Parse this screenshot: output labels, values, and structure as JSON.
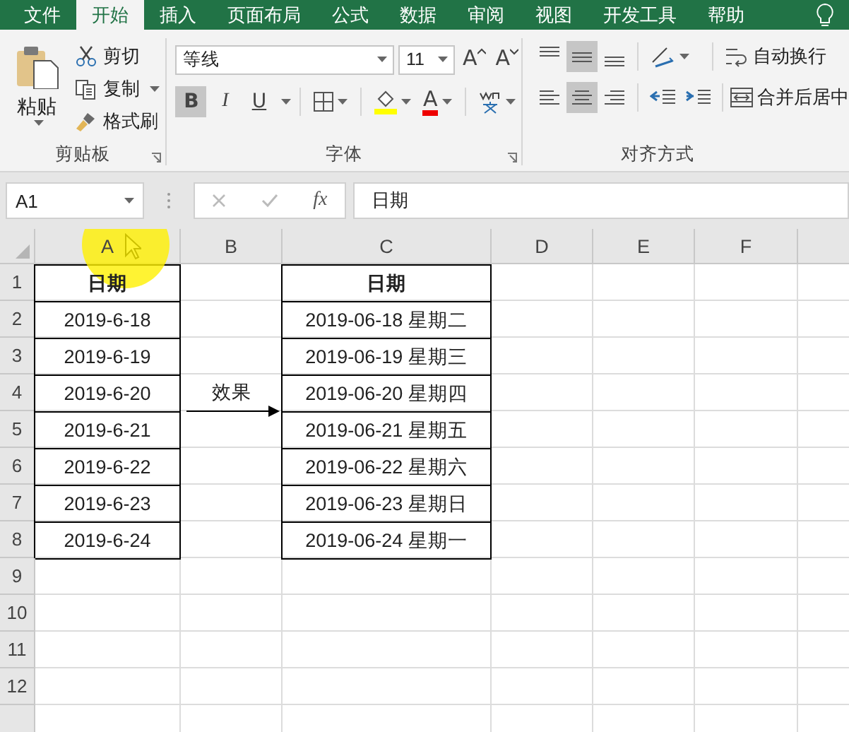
{
  "menu_tabs": [
    {
      "label": "文件",
      "selected": false
    },
    {
      "label": "开始",
      "selected": true
    },
    {
      "label": "插入",
      "selected": false
    },
    {
      "label": "页面布局",
      "selected": false
    },
    {
      "label": "公式",
      "selected": false
    },
    {
      "label": "数据",
      "selected": false
    },
    {
      "label": "审阅",
      "selected": false
    },
    {
      "label": "视图",
      "selected": false
    },
    {
      "label": "开发工具",
      "selected": false
    },
    {
      "label": "帮助",
      "selected": false
    }
  ],
  "ribbon": {
    "clipboard": {
      "paste": "粘贴",
      "actions": [
        {
          "kind": "cut",
          "label": "剪切"
        },
        {
          "kind": "copy",
          "label": "复制"
        },
        {
          "kind": "painter",
          "label": "格式刷"
        }
      ],
      "label": "剪贴板"
    },
    "font": {
      "font_name": "等线",
      "font_size": "11",
      "grow_font": "A",
      "shrink_font": "A",
      "styles": [
        {
          "kind": "bold",
          "label": "B",
          "selected": true
        },
        {
          "kind": "italic",
          "label": "I",
          "selected": false
        },
        {
          "kind": "underline",
          "label": "U",
          "selected": false
        }
      ],
      "font_color": "A",
      "label": "字体"
    },
    "alignment": {
      "vertical_align": [
        {
          "kind": "top",
          "selected": false
        },
        {
          "kind": "middle",
          "selected": true
        },
        {
          "kind": "bottom",
          "selected": false
        }
      ],
      "horizontal_align": [
        {
          "kind": "left",
          "selected": false
        },
        {
          "kind": "center",
          "selected": true
        },
        {
          "kind": "right",
          "selected": false
        }
      ],
      "wrap_text": "自动换行",
      "merge_center": "合并后居中",
      "label": "对齐方式"
    }
  },
  "formula_bar": {
    "name_box": "A1",
    "function_button": "fx",
    "content": "日期"
  },
  "sheet": {
    "columns": [
      "A",
      "B",
      "C",
      "D",
      "E",
      "F"
    ],
    "rows": [
      {
        "number": "1",
        "kind": "header",
        "a": "日期",
        "c": "日期"
      },
      {
        "number": "2",
        "kind": "data",
        "a": "2019-6-18",
        "c": "2019-06-18 星期二"
      },
      {
        "number": "3",
        "kind": "data",
        "a": "2019-6-19",
        "c": "2019-06-19 星期三"
      },
      {
        "number": "4",
        "kind": "data",
        "a": "2019-6-20",
        "b": "效果",
        "c": "2019-06-20 星期四"
      },
      {
        "number": "5",
        "kind": "data",
        "a": "2019-6-21",
        "c": "2019-06-21 星期五"
      },
      {
        "number": "6",
        "kind": "data",
        "a": "2019-6-22",
        "c": "2019-06-22 星期六"
      },
      {
        "number": "7",
        "kind": "data",
        "a": "2019-6-23",
        "c": "2019-06-23 星期日"
      },
      {
        "number": "8",
        "kind": "data",
        "a": "2019-6-24",
        "c": "2019-06-24 星期一"
      },
      {
        "number": "9",
        "kind": "empty"
      },
      {
        "number": "10",
        "kind": "empty"
      },
      {
        "number": "11",
        "kind": "empty"
      },
      {
        "number": "12",
        "kind": "empty"
      }
    ]
  }
}
